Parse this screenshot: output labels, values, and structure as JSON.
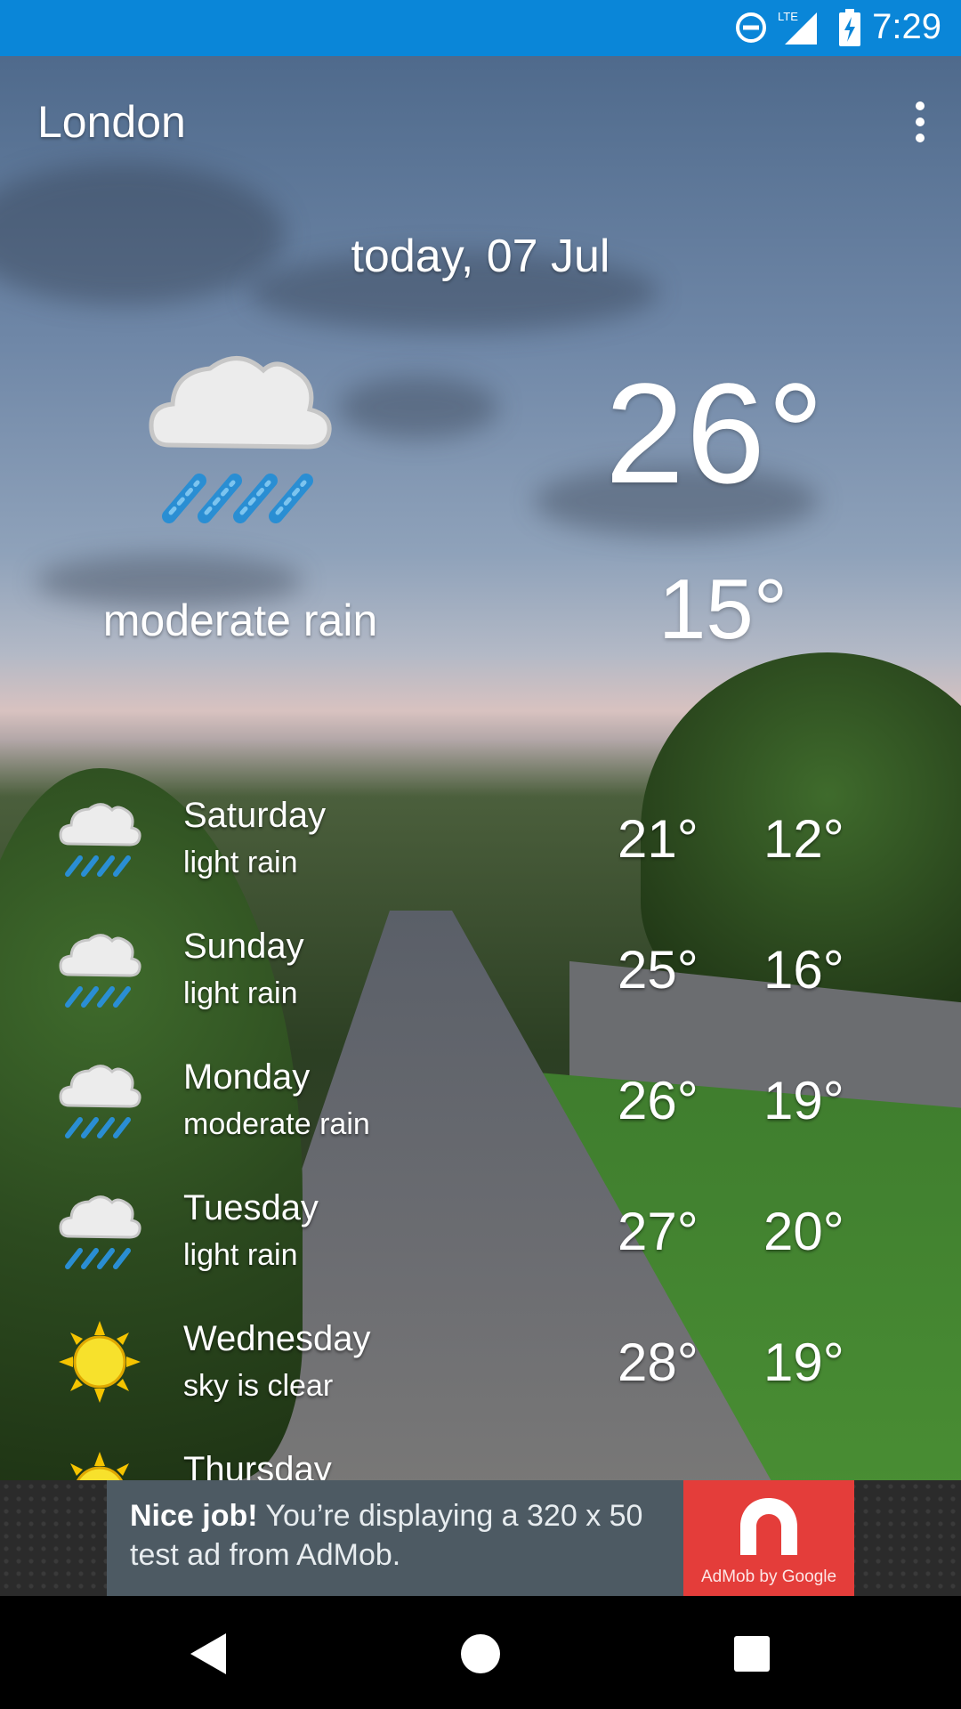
{
  "status_bar": {
    "time": "7:29",
    "network": "LTE",
    "icons": [
      "do-not-disturb-icon",
      "lte-signal-icon",
      "battery-charging-icon"
    ]
  },
  "app_bar": {
    "title": "London",
    "menu_icon": "more-vert-icon"
  },
  "today": {
    "date": "today, 07 Jul",
    "high": "26°",
    "low": "15°",
    "condition": "moderate rain",
    "icon": "rain-cloud-icon"
  },
  "forecast": [
    {
      "day": "Saturday",
      "condition": "light rain",
      "high": "21°",
      "low": "12°",
      "icon": "rain-cloud-icon"
    },
    {
      "day": "Sunday",
      "condition": "light rain",
      "high": "25°",
      "low": "16°",
      "icon": "rain-cloud-icon"
    },
    {
      "day": "Monday",
      "condition": "moderate rain",
      "high": "26°",
      "low": "19°",
      "icon": "rain-cloud-icon"
    },
    {
      "day": "Tuesday",
      "condition": "light rain",
      "high": "27°",
      "low": "20°",
      "icon": "rain-cloud-icon"
    },
    {
      "day": "Wednesday",
      "condition": "sky is clear",
      "high": "28°",
      "low": "19°",
      "icon": "sun-icon"
    },
    {
      "day": "Thursday",
      "condition": "",
      "high": "",
      "low": "",
      "icon": "sun-icon"
    }
  ],
  "ad": {
    "bold": "Nice job!",
    "text": " You’re displaying a 320 x 50 test ad from AdMob.",
    "brand": "AdMob by Google"
  },
  "nav_bar": {
    "icons": [
      "back-icon",
      "home-icon",
      "recents-icon"
    ]
  },
  "colors": {
    "status_bar": "#0a86d8",
    "ad_background": "#4d5a63",
    "ad_logo": "#e43d3a"
  }
}
